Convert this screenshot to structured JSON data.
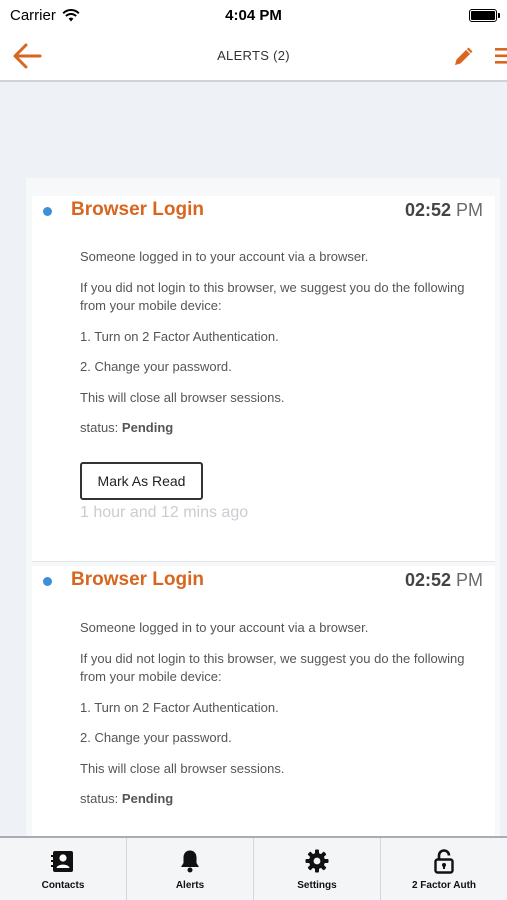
{
  "status_bar": {
    "carrier": "Carrier",
    "time": "4:04 PM"
  },
  "nav": {
    "title": "ALERTS (2)"
  },
  "alerts": [
    {
      "title": "Browser Login",
      "time_main": "02:52",
      "time_ampm": "PM",
      "line1": "Someone logged in to your account via a browser.",
      "line2a": "If you did not login to this browser, we suggest you do the following",
      "line2b": "from your mobile device:",
      "line3": "1. Turn on 2 Factor Authentication.",
      "line4": "2. Change your password.",
      "line5": "This will close all browser sessions.",
      "status_label": "status:",
      "status_value": "Pending",
      "button_label": "Mark As Read",
      "ago": "1 hour and 12 mins ago"
    },
    {
      "title": "Browser Login",
      "time_main": "02:52",
      "time_ampm": "PM",
      "line1": "Someone logged in to your account via a browser.",
      "line2a": "If you did not login to this browser, we suggest you do the following",
      "line2b": "from your mobile device:",
      "line3": "1. Turn on 2 Factor Authentication.",
      "line4": "2. Change your password.",
      "line5": "This will close all browser sessions.",
      "status_label": "status:",
      "status_value": "Pending"
    }
  ],
  "tabs": [
    {
      "label": "Contacts",
      "icon": "contacts-icon"
    },
    {
      "label": "Alerts",
      "icon": "bell-icon"
    },
    {
      "label": "Settings",
      "icon": "gear-icon"
    },
    {
      "label": "2 Factor Auth",
      "icon": "lock-icon"
    }
  ],
  "colors": {
    "accent": "#d9661f",
    "unread_dot": "#3d8fd8"
  }
}
